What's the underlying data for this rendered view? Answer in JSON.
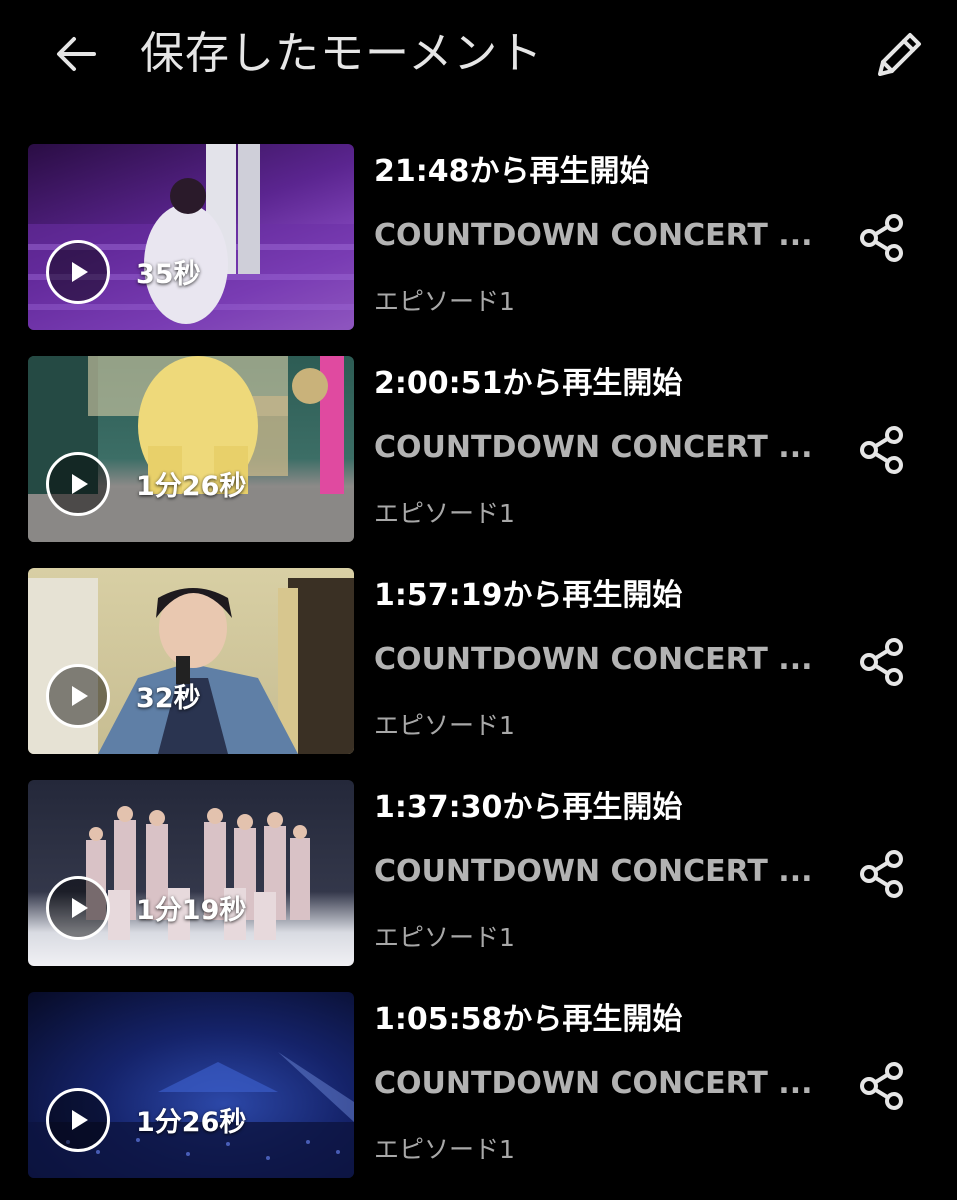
{
  "header": {
    "title": "保存したモーメント",
    "back_icon": "arrow-left-icon",
    "edit_icon": "pencil-icon"
  },
  "moments": [
    {
      "duration": "35秒",
      "resume": "21:48から再生開始",
      "show_title": "COUNTDOWN CONCERT ...",
      "episode": "エピソード1",
      "thumb_colors": [
        "#3a1a5e",
        "#7a3ab0",
        "#c98be6"
      ]
    },
    {
      "duration": "1分26秒",
      "resume": "2:00:51から再生開始",
      "show_title": "COUNTDOWN CONCERT ...",
      "episode": "エピソード1",
      "thumb_colors": [
        "#2f5a52",
        "#e8d37a",
        "#8f8a86"
      ]
    },
    {
      "duration": "32秒",
      "resume": "1:57:19から再生開始",
      "show_title": "COUNTDOWN CONCERT ...",
      "episode": "エピソード1",
      "thumb_colors": [
        "#d9cfa3",
        "#6e8fb0",
        "#2b3a55"
      ]
    },
    {
      "duration": "1分19秒",
      "resume": "1:37:30から再生開始",
      "show_title": "COUNTDOWN CONCERT ...",
      "episode": "エピソード1",
      "thumb_colors": [
        "#2a2a3a",
        "#c9b4b8",
        "#e9e9ee"
      ]
    },
    {
      "duration": "1分26秒",
      "resume": "1:05:58から再生開始",
      "show_title": "COUNTDOWN CONCERT ...",
      "episode": "エピソード1",
      "thumb_colors": [
        "#0a1030",
        "#1c2f7a",
        "#3b58b8"
      ]
    }
  ],
  "icons": {
    "play": "play-icon",
    "share": "share-icon"
  }
}
